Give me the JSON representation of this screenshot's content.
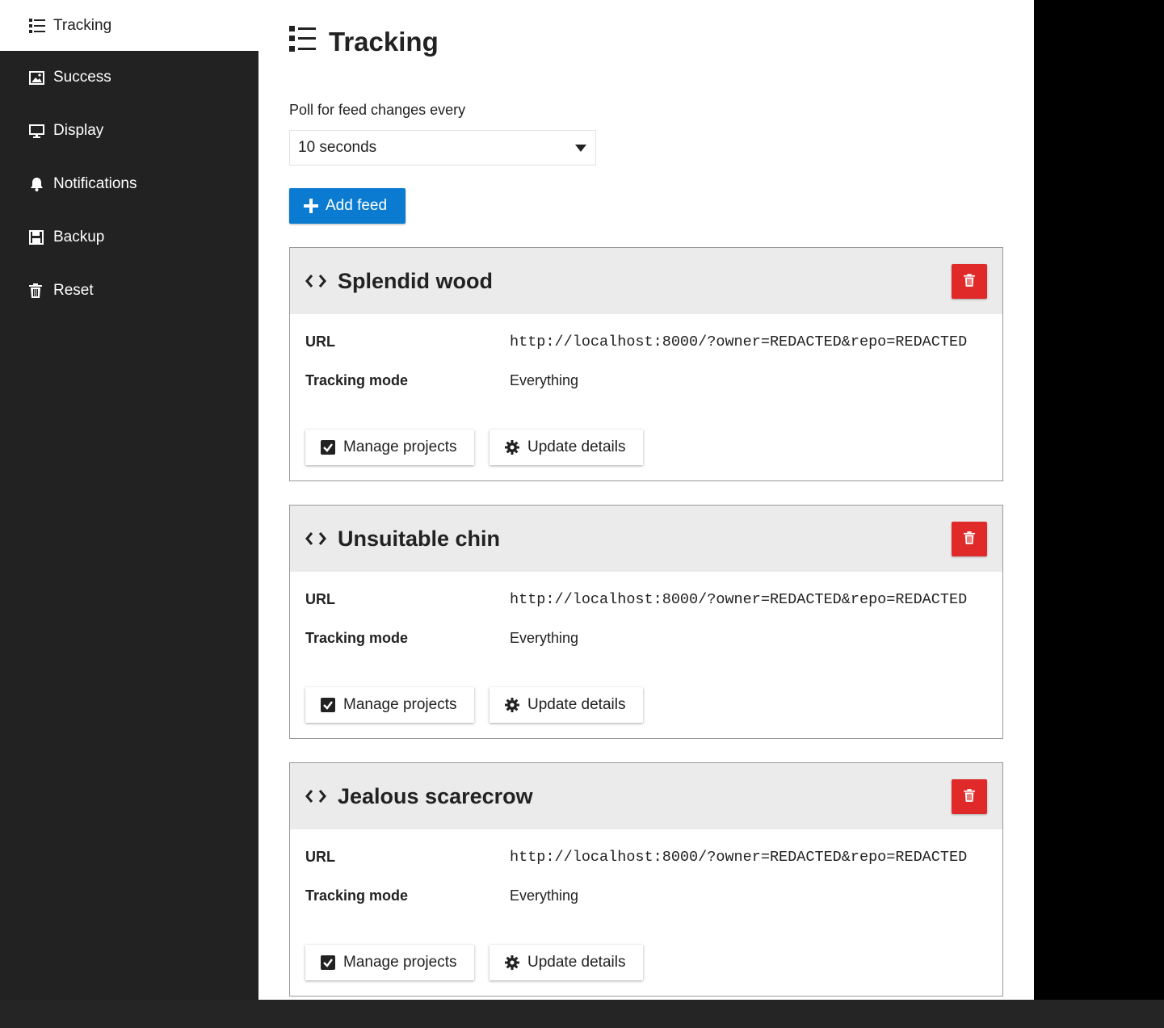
{
  "sidebar": {
    "items": [
      {
        "label": "Tracking",
        "icon": "list-icon",
        "active": true
      },
      {
        "label": "Success",
        "icon": "image-icon",
        "active": false
      },
      {
        "label": "Display",
        "icon": "monitor-icon",
        "active": false
      },
      {
        "label": "Notifications",
        "icon": "bell-icon",
        "active": false
      },
      {
        "label": "Backup",
        "icon": "save-icon",
        "active": false
      },
      {
        "label": "Reset",
        "icon": "trash-icon",
        "active": false
      }
    ]
  },
  "page": {
    "title": "Tracking",
    "poll_label": "Poll for feed changes every",
    "poll_value": "10 seconds",
    "add_feed_label": "Add feed"
  },
  "feed_labels": {
    "url_key": "URL",
    "mode_key": "Tracking mode",
    "manage_label": "Manage projects",
    "update_label": "Update details"
  },
  "feeds": [
    {
      "title": "Splendid wood",
      "url": "http://localhost:8000/?owner=REDACTED&repo=REDACTED",
      "mode": "Everything"
    },
    {
      "title": "Unsuitable chin",
      "url": "http://localhost:8000/?owner=REDACTED&repo=REDACTED",
      "mode": "Everything"
    },
    {
      "title": "Jealous scarecrow",
      "url": "http://localhost:8000/?owner=REDACTED&repo=REDACTED",
      "mode": "Everything"
    }
  ],
  "colors": {
    "primary": "#0a7bd0",
    "danger": "#e02a2a",
    "sidebar": "#222222"
  }
}
